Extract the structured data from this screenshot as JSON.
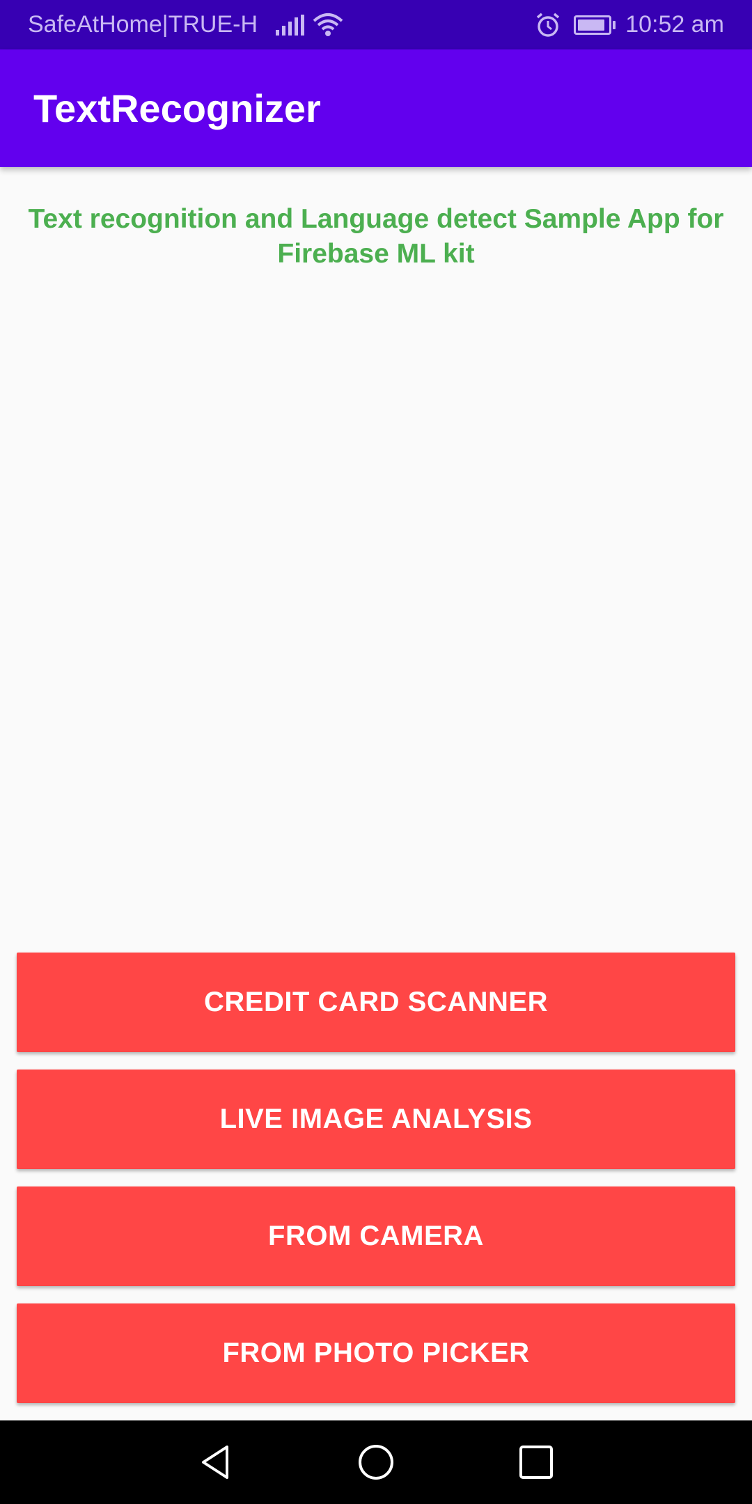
{
  "status_bar": {
    "carrier": "SafeAtHome|TRUE-H",
    "time": "10:52 am",
    "battery_level": 0.9,
    "icons": [
      "signal-icon",
      "wifi-icon",
      "alarm-icon",
      "battery-icon"
    ]
  },
  "app_bar": {
    "title": "TextRecognizer",
    "color": "#6200ee"
  },
  "main": {
    "subtitle": "Text recognition and Language detect Sample App for Firebase ML kit",
    "subtitle_color": "#4caf50",
    "buttons": [
      {
        "label": "CREDIT CARD SCANNER"
      },
      {
        "label": "LIVE IMAGE ANALYSIS"
      },
      {
        "label": "FROM CAMERA"
      },
      {
        "label": "FROM PHOTO PICKER"
      }
    ],
    "button_color": "#ff4646"
  },
  "nav_bar": {
    "icons": [
      "back-icon",
      "home-icon",
      "recents-icon"
    ]
  }
}
